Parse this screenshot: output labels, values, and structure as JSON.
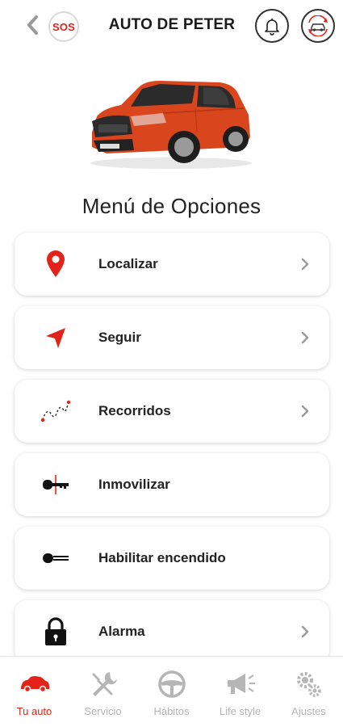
{
  "colors": {
    "accent": "#e2231a",
    "inactive": "#b5b5b5",
    "text": "#222222"
  },
  "header": {
    "title": "AUTO DE PETER",
    "sos_label": "SOS",
    "back_icon": "chevron-left-icon",
    "bell_icon": "bell-icon",
    "switch_icon": "car-switch-icon"
  },
  "main": {
    "menu_title": "Menú de Opciones",
    "options": [
      {
        "label": "Localizar",
        "icon": "location-pin-icon",
        "has_chevron": true
      },
      {
        "label": "Seguir",
        "icon": "navigation-arrow-icon",
        "has_chevron": true
      },
      {
        "label": "Recorridos",
        "icon": "route-icon",
        "has_chevron": true
      },
      {
        "label": "Inmovilizar",
        "icon": "key-immobilize-icon",
        "has_chevron": false
      },
      {
        "label": "Habilitar encendido",
        "icon": "key-icon",
        "has_chevron": false
      },
      {
        "label": "Alarma",
        "icon": "lock-icon",
        "has_chevron": true
      }
    ]
  },
  "tabbar": {
    "tabs": [
      {
        "label": "Tu auto",
        "icon": "car-icon",
        "active": true
      },
      {
        "label": "Servicio",
        "icon": "tools-icon",
        "active": false
      },
      {
        "label": "Hábitos",
        "icon": "steering-wheel-icon",
        "active": false
      },
      {
        "label": "Life style",
        "icon": "megaphone-icon",
        "active": false
      },
      {
        "label": "Ajustes",
        "icon": "gears-icon",
        "active": false
      }
    ]
  }
}
